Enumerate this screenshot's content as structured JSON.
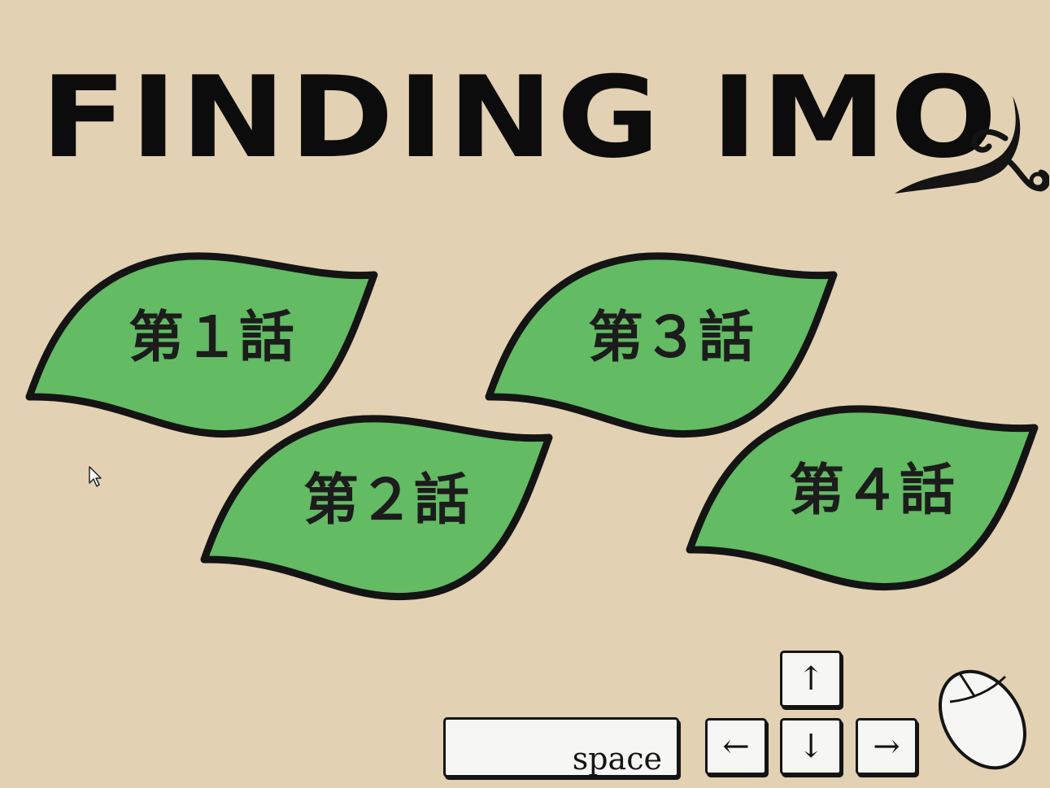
{
  "game": {
    "title": "FINDING IMO"
  },
  "chapters": [
    {
      "label": "第１話"
    },
    {
      "label": "第２話"
    },
    {
      "label": "第３話"
    },
    {
      "label": "第４話"
    }
  ],
  "controls": {
    "space_label": "space",
    "up_label": "↑",
    "left_label": "←",
    "down_label": "↓",
    "right_label": "→"
  },
  "colors": {
    "background": "#e3d1b3",
    "leaf_fill": "#63bb63",
    "outline": "#141414"
  }
}
